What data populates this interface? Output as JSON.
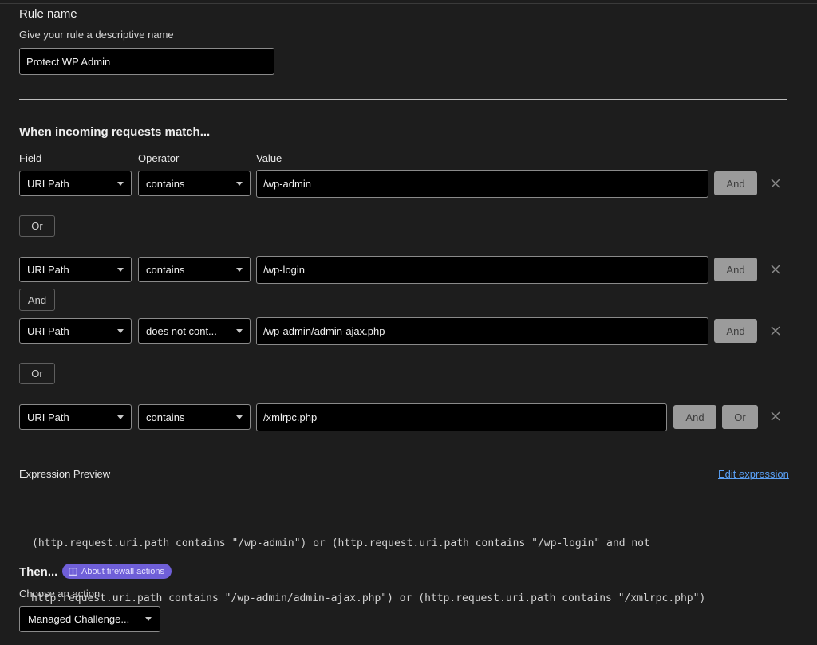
{
  "rule_name": {
    "heading": "Rule name",
    "hint": "Give your rule a descriptive name",
    "value": "Protect WP Admin"
  },
  "match": {
    "heading": "When incoming requests match...",
    "col_field": "Field",
    "col_operator": "Operator",
    "col_value": "Value",
    "rows": [
      {
        "field": "URI Path",
        "operator": "contains",
        "value": "/wp-admin",
        "and_label": "And"
      },
      {
        "field": "URI Path",
        "operator": "contains",
        "value": "/wp-login",
        "and_label": "And"
      },
      {
        "field": "URI Path",
        "operator": "does not cont...",
        "value": "/wp-admin/admin-ajax.php",
        "and_label": "And"
      },
      {
        "field": "URI Path",
        "operator": "contains",
        "value": "/xmlrpc.php",
        "and_label": "And",
        "or_label": "Or"
      }
    ],
    "or_connector_1": "Or",
    "and_connector": "And",
    "or_connector_2": "Or"
  },
  "expression": {
    "label": "Expression Preview",
    "edit_link": "Edit expression",
    "line1": "(http.request.uri.path contains \"/wp-admin\") or (http.request.uri.path contains \"/wp-login\" and not",
    "line2": "http.request.uri.path contains \"/wp-admin/admin-ajax.php\") or (http.request.uri.path contains \"/xmlrpc.php\")"
  },
  "action": {
    "heading": "Then...",
    "badge": "About firewall actions",
    "badge_icon": "book-icon",
    "hint": "Choose an action",
    "selected": "Managed Challenge..."
  },
  "colors": {
    "background": "#1d1d1d",
    "badge": "#6f5fd8",
    "link": "#5aa0f5",
    "button_gray": "#9b9b9b"
  }
}
